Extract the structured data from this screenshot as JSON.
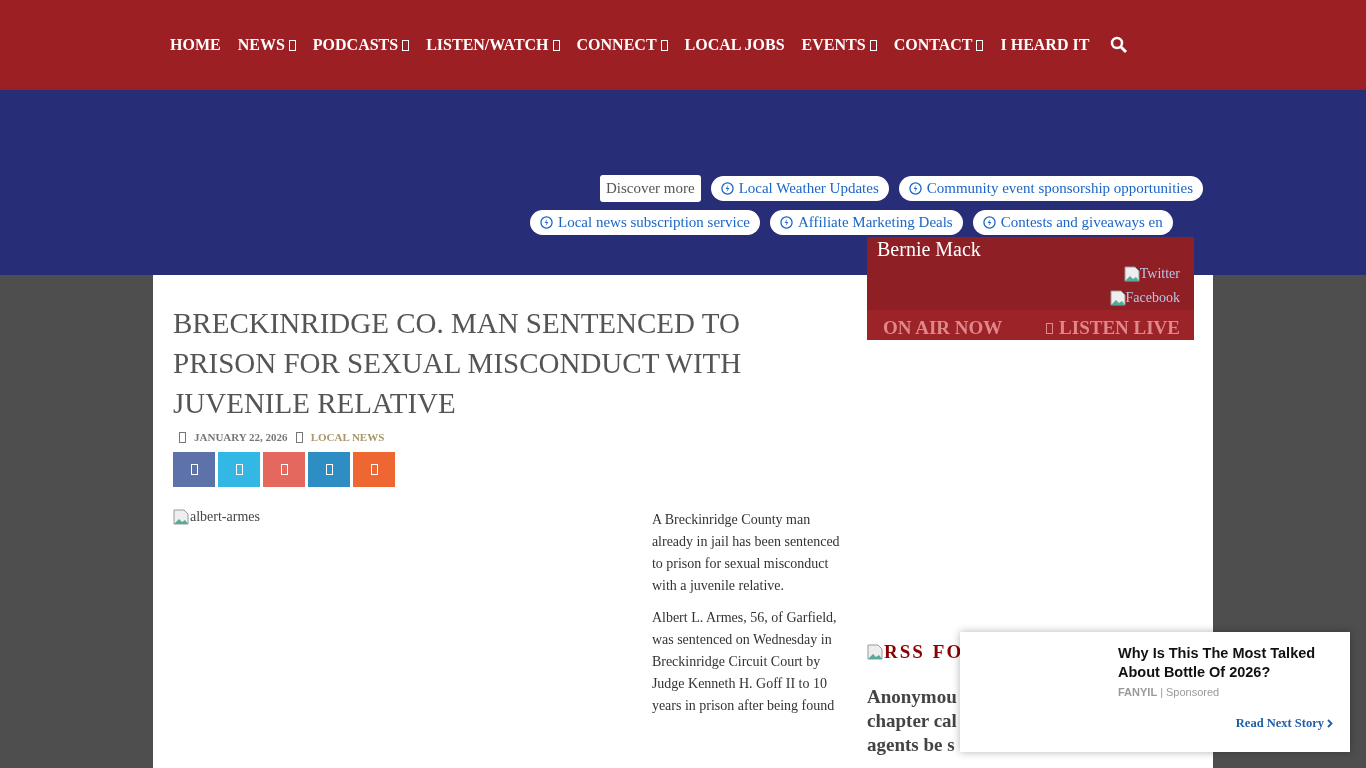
{
  "nav": {
    "items": [
      {
        "label": "HOME",
        "dropdown": false
      },
      {
        "label": "NEWS",
        "dropdown": true
      },
      {
        "label": "PODCASTS",
        "dropdown": true
      },
      {
        "label": "LISTEN/WATCH",
        "dropdown": true
      },
      {
        "label": "CONNECT",
        "dropdown": true
      },
      {
        "label": "LOCAL JOBS",
        "dropdown": false
      },
      {
        "label": "EVENTS",
        "dropdown": true
      },
      {
        "label": "CONTACT",
        "dropdown": true
      },
      {
        "label": "I HEARD IT",
        "dropdown": false
      }
    ]
  },
  "discover": {
    "label": "Discover more",
    "chips_row1": [
      "Local Weather Updates",
      "Community event sponsorship opportunities"
    ],
    "chips_row2": [
      "Local news subscription service",
      "Affiliate Marketing Deals",
      "Contests and giveaways en"
    ]
  },
  "article": {
    "title": "BRECKINRIDGE CO. MAN SENTENCED TO PRISON FOR SEXUAL MISCONDUCT WITH JUVENILE RELATIVE",
    "date": "JANUARY 22, 2026",
    "category": "LOCAL NEWS",
    "share_buttons": [
      {
        "color": "#5d72a9"
      },
      {
        "color": "#33b8e6"
      },
      {
        "color": "#e5685f"
      },
      {
        "color": "#2e8dc3"
      },
      {
        "color": "#ee6733"
      }
    ],
    "image_alt": "albert-armes",
    "paragraphs": [
      "A Breckinridge County man already in jail has been sentenced to prison for sexual misconduct with a juvenile relative.",
      "Albert L. Armes, 56, of Garfield, was sentenced on Wednesday in Breckinridge Circuit Court by Judge Kenneth H. Goff II to 10 years in prison after being found"
    ]
  },
  "radio": {
    "host": "Bernie Mack",
    "links": [
      "Twitter",
      "Facebook"
    ],
    "on_air": "ON AIR NOW",
    "listen": "LISTEN LIVE"
  },
  "sidebar": {
    "rss_alt": "RSS",
    "heading": "FO",
    "story_lines": [
      "Anonymou",
      "chapter cal",
      "agents be s"
    ]
  },
  "ad": {
    "headline": "Why Is This The Most Talked About Bottle Of 2026?",
    "brand": "FANYIL",
    "separator": "|",
    "sponsored": "Sponsored",
    "read_next": "Read Next Story"
  }
}
